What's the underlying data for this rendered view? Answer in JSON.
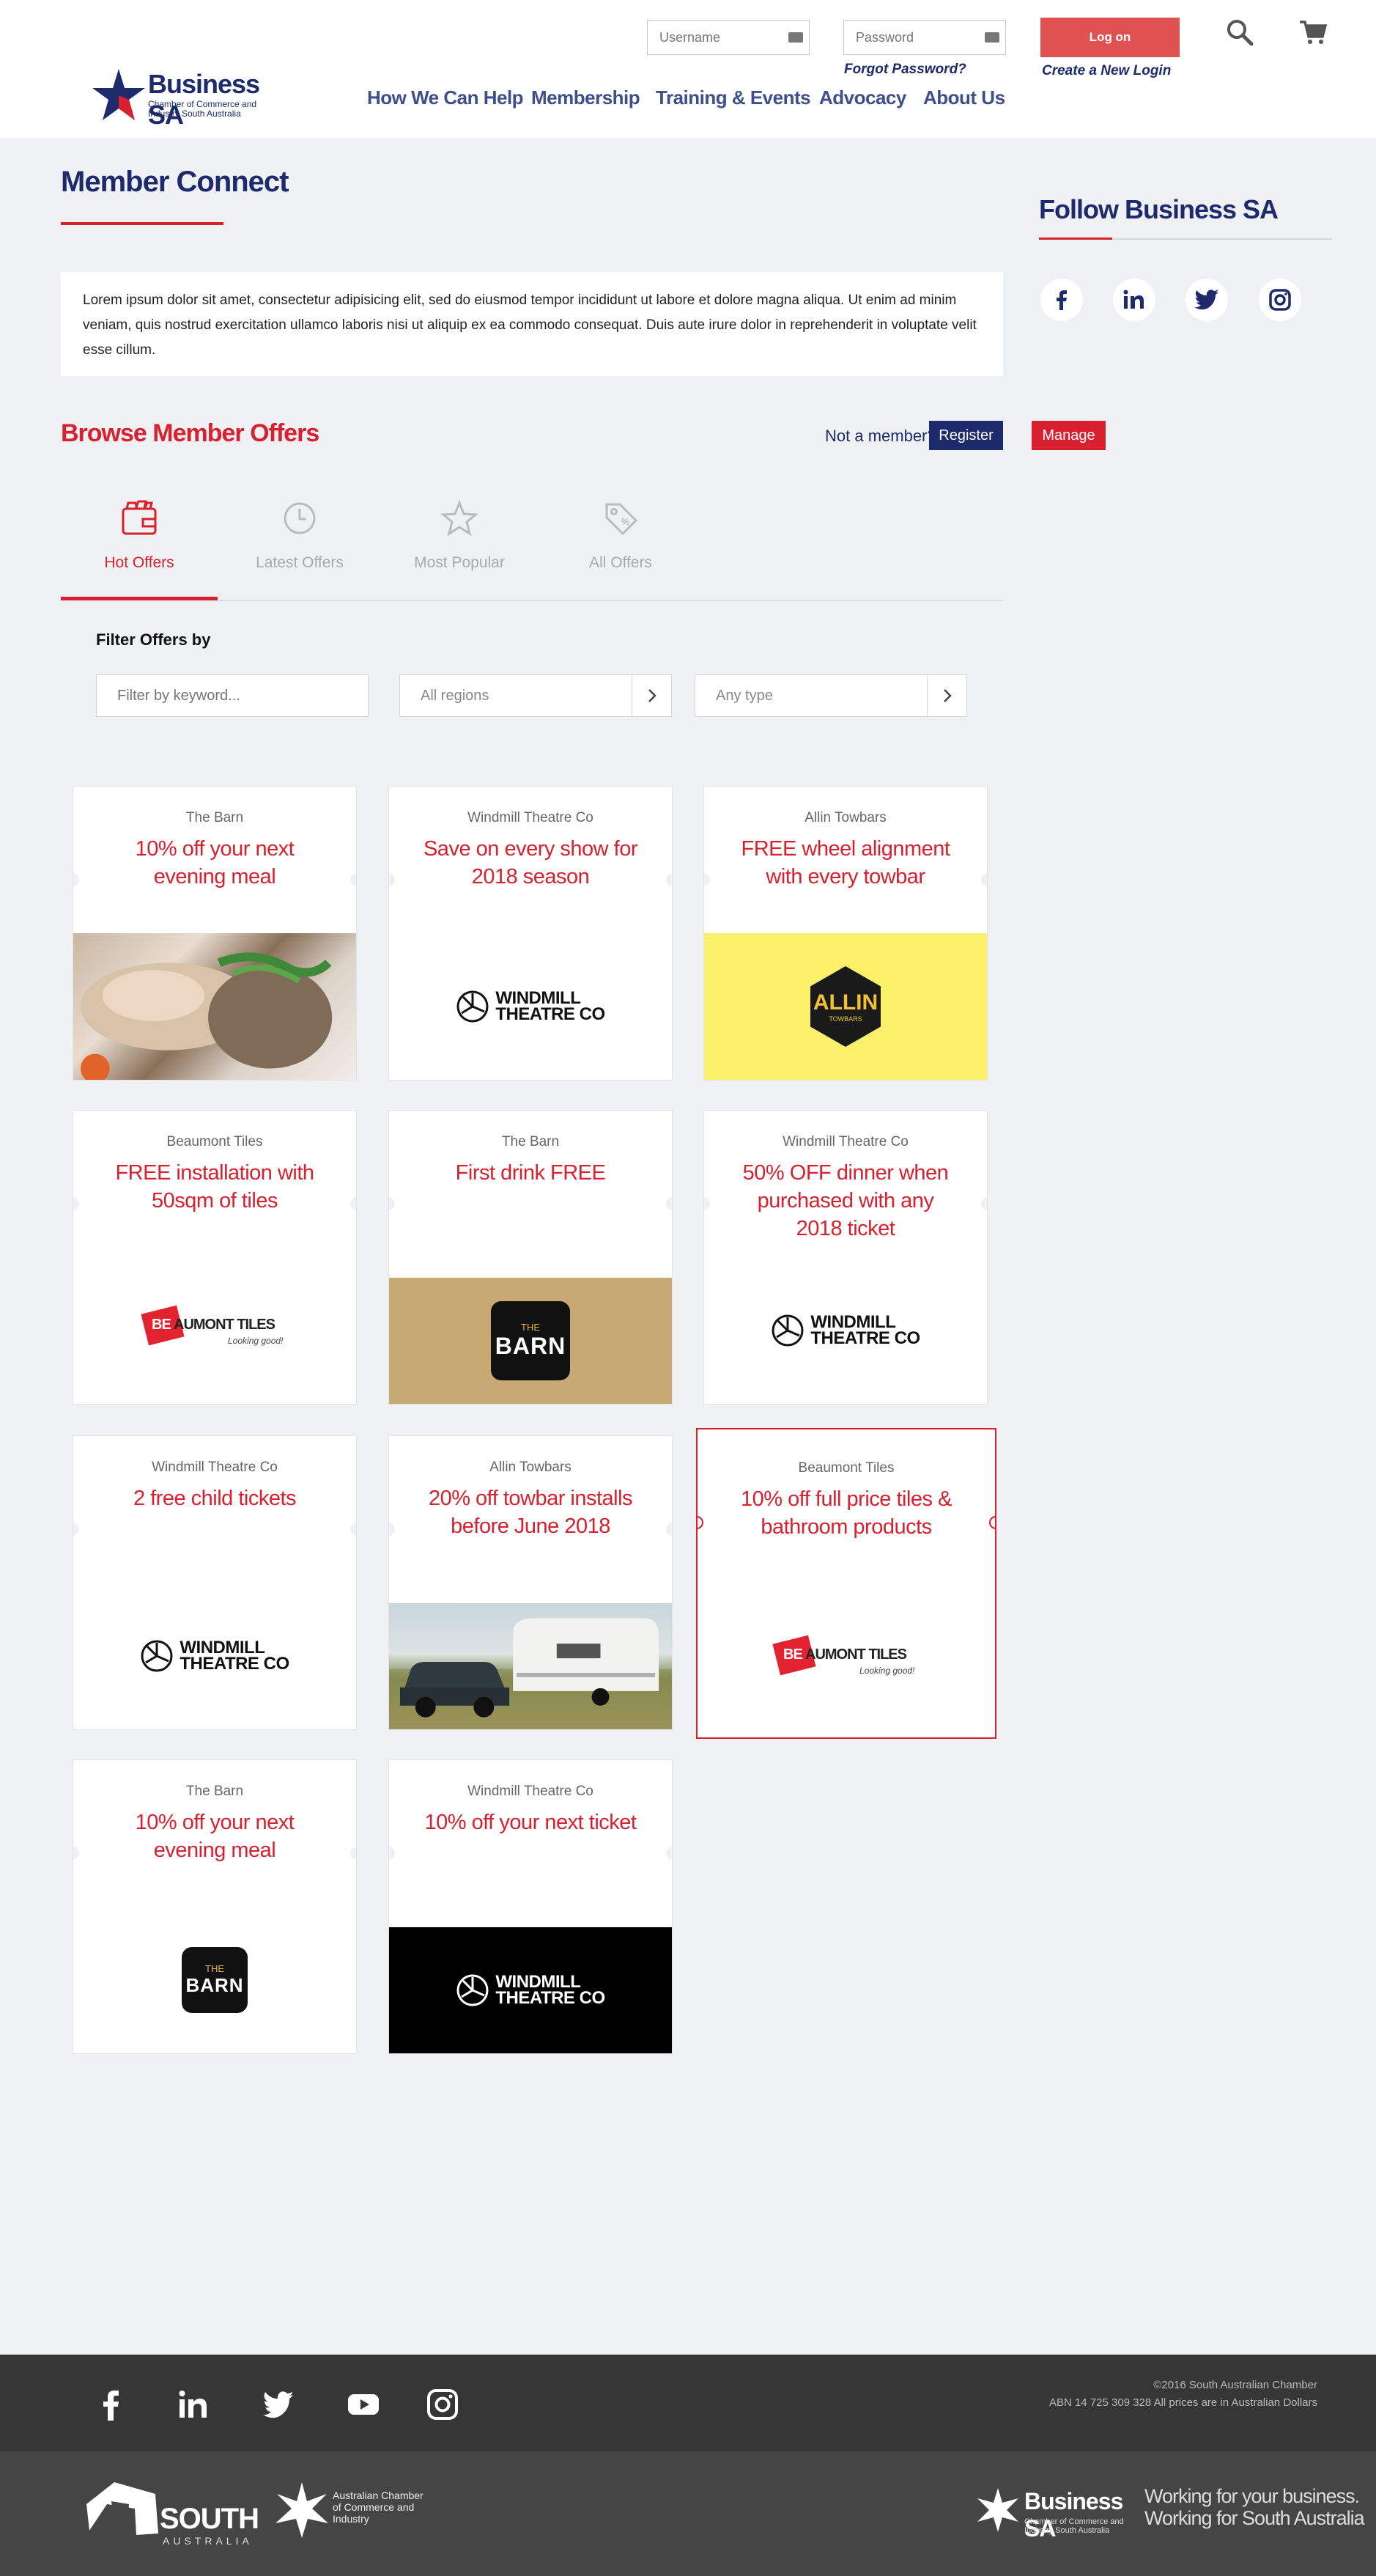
{
  "header": {
    "logo": {
      "brand": "Business SA",
      "sub": "Chamber of Commerce and Industry South Australia"
    },
    "username_placeholder": "Username",
    "password_placeholder": "Password",
    "login_label": "Log on",
    "forgot_password": "Forgot Password?",
    "create_login": "Create a New Login",
    "nav": [
      "How We Can Help",
      "Membership",
      "Training & Events",
      "Advocacy",
      "About Us"
    ]
  },
  "main": {
    "title": "Member Connect",
    "intro": "Lorem ipsum dolor sit amet, consectetur adipisicing elit, sed do eiusmod tempor incididunt ut labore et dolore magna aliqua. Ut enim ad minim veniam, quis nostrud exercitation ullamco laboris nisi ut aliquip ex ea commodo consequat. Duis aute irure dolor in reprehenderit in voluptate velit esse cillum.",
    "browse_title": "Browse Member Offers",
    "not_member": "Not a member?",
    "register_label": "Register",
    "manage_label": "Manage",
    "tabs": [
      {
        "label": "Hot Offers",
        "icon": "wallet-icon",
        "active": true
      },
      {
        "label": "Latest Offers",
        "icon": "clock-icon",
        "active": false
      },
      {
        "label": "Most Popular",
        "icon": "star-icon",
        "active": false
      },
      {
        "label": "All Offers",
        "icon": "tag-icon",
        "active": false
      }
    ],
    "filter": {
      "label": "Filter Offers by",
      "keyword_placeholder": "Filter by keyword...",
      "region_value": "All regions",
      "type_value": "Any type"
    }
  },
  "sidebar": {
    "title": "Follow Business SA",
    "social": [
      "facebook-icon",
      "linkedin-icon",
      "twitter-icon",
      "instagram-icon"
    ]
  },
  "offers": [
    {
      "vendor": "The Barn",
      "offer": "10% off your next evening meal",
      "visual": "food-photo"
    },
    {
      "vendor": "Windmill Theatre Co",
      "offer": "Save on every show for 2018 season",
      "visual": "windmill-logo"
    },
    {
      "vendor": "Allin Towbars",
      "offer": "FREE wheel alignment with every towbar",
      "visual": "allin-logo"
    },
    {
      "vendor": "Beaumont Tiles",
      "offer": "FREE installation with 50sqm of tiles",
      "visual": "beaumont-logo"
    },
    {
      "vendor": "The Barn",
      "offer": "First drink FREE",
      "visual": "barn-logo-tan"
    },
    {
      "vendor": "Windmill Theatre Co",
      "offer": "50% OFF dinner when purchased with any 2018 ticket",
      "visual": "windmill-logo"
    },
    {
      "vendor": "Windmill Theatre Co",
      "offer": "2 free child tickets",
      "visual": "windmill-logo"
    },
    {
      "vendor": "Allin Towbars",
      "offer": "20% off towbar installs before June 2018",
      "visual": "caravan-photo"
    },
    {
      "vendor": "Beaumont Tiles",
      "offer": "10% off full price tiles & bathroom products",
      "visual": "beaumont-logo"
    },
    {
      "vendor": "The Barn",
      "offer": "10% off your next evening meal",
      "visual": "barn-logo"
    },
    {
      "vendor": "Windmill Theatre Co",
      "offer": "10% off your next ticket",
      "visual": "windmill-logo-dark"
    }
  ],
  "logo_text": {
    "windmill_line1": "WINDMILL",
    "windmill_line2": "THEATRE CO",
    "beaumont_pre": "BE",
    "beaumont_main": "AUMONT TILES",
    "beaumont_tag": "Looking good!",
    "barn_the": "THE",
    "barn_name": "BARN",
    "allin_name": "ALLIN",
    "allin_tag": "TOWBARS"
  },
  "footer": {
    "social": [
      "facebook-icon",
      "linkedin-icon",
      "twitter-icon",
      "youtube-icon",
      "instagram-icon"
    ],
    "copyright": "©2016 South Australian Chamber",
    "abn": "ABN 14 725 309 328 All prices are in Australian Dollars",
    "sa_logo": "SOUTH",
    "sa_logo_sub": "AUSTRALIA",
    "acci": "Australian Chamber of Commerce and Industry",
    "bsa_brand": "Business SA",
    "bsa_sub": "Chamber of Commerce and Industry South Australia",
    "tagline1": "Working for your business.",
    "tagline2": "Working for South Australia"
  },
  "colors": {
    "navy": "#1d2a6b",
    "red": "#d8202f",
    "login": "#e05252",
    "footer": "#363636"
  }
}
